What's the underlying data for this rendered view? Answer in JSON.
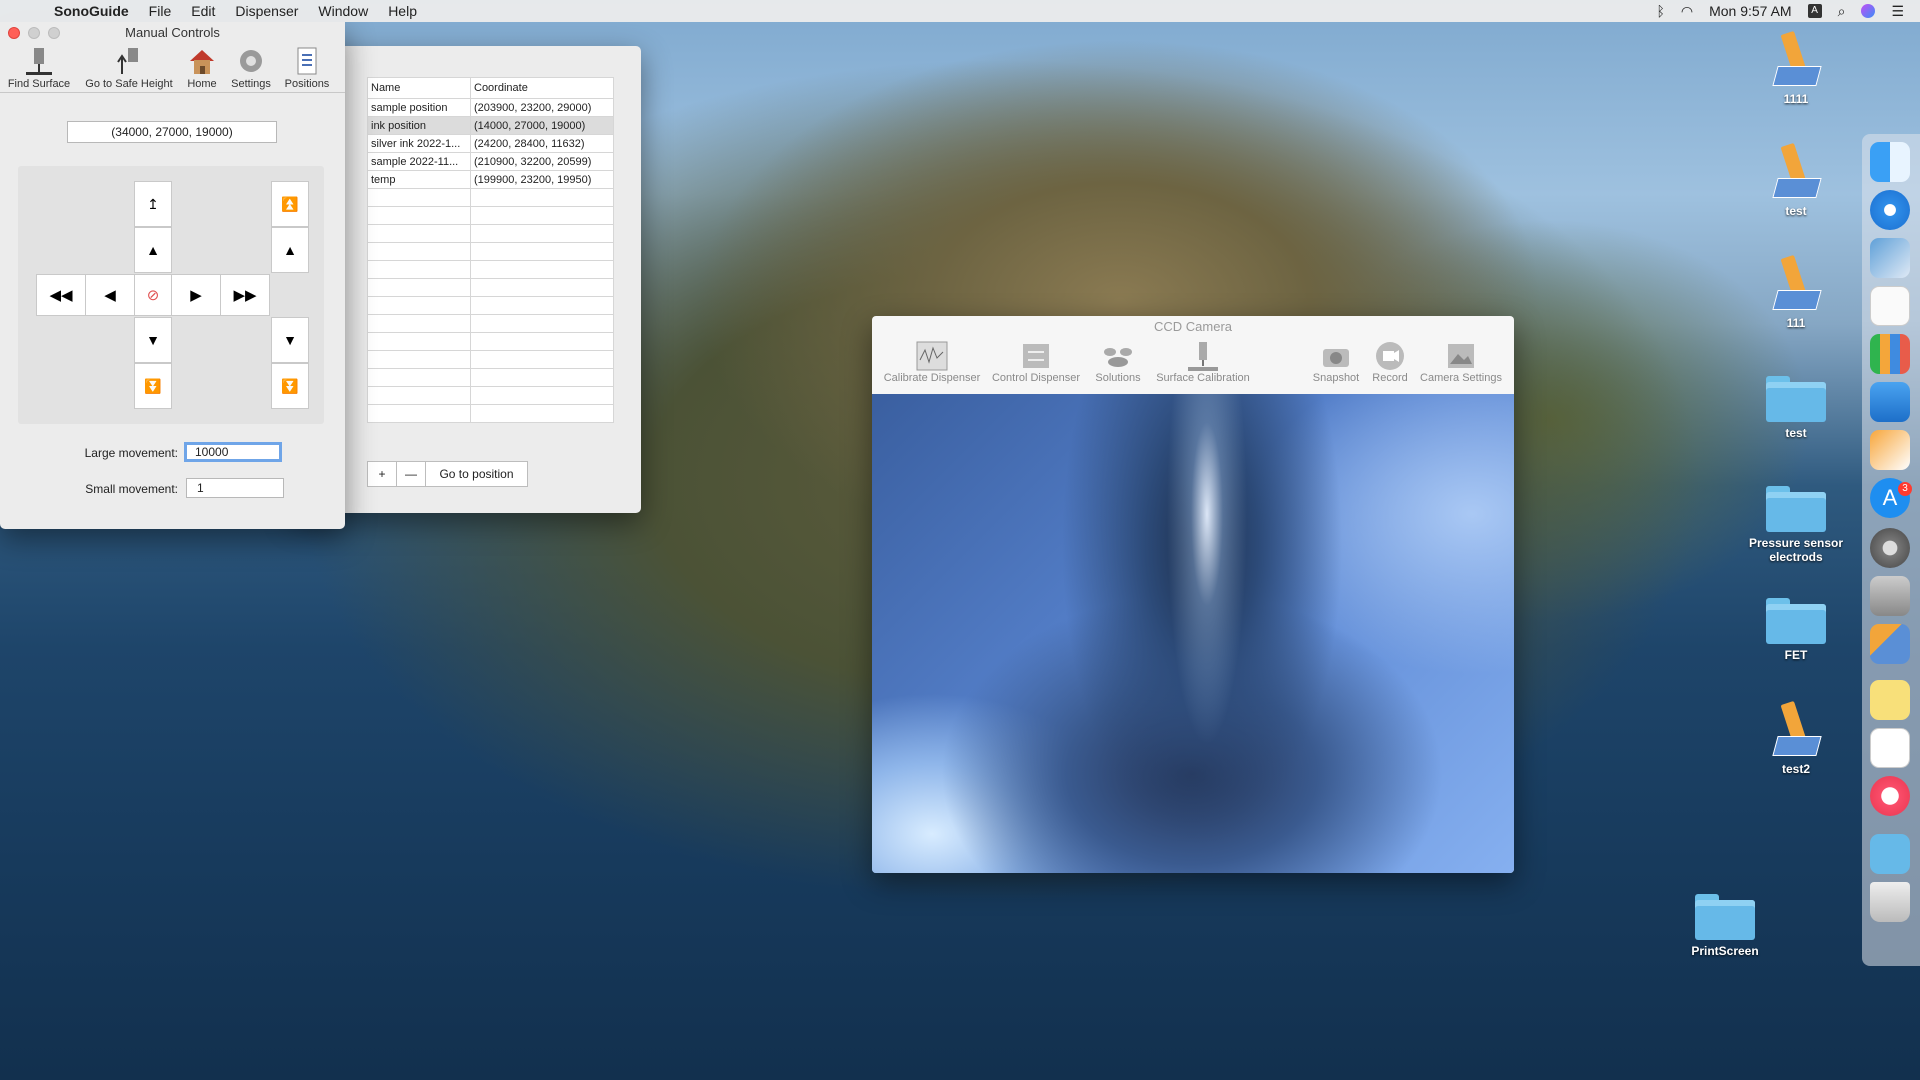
{
  "menubar": {
    "app_name": "SonoGuide",
    "menus": [
      "File",
      "Edit",
      "Dispenser",
      "Window",
      "Help"
    ],
    "clock": "Mon 9:57 AM",
    "input_source": "A"
  },
  "manual_controls": {
    "title": "Manual Controls",
    "toolbar": {
      "find_surface": "Find Surface",
      "safe_height": "Go to Safe Height",
      "home": "Home",
      "settings": "Settings",
      "positions": "Positions"
    },
    "current_coordinate": "(34000, 27000, 19000)",
    "large_movement_label": "Large movement:",
    "large_movement_value": "10000",
    "small_movement_label": "Small movement:",
    "small_movement_value": "1"
  },
  "positions": {
    "columns": [
      "Name",
      "Coordinate"
    ],
    "rows": [
      {
        "name": "sample position",
        "coord": "(203900, 23200, 29000)"
      },
      {
        "name": "ink position",
        "coord": "(14000, 27000, 19000)"
      },
      {
        "name": "silver ink 2022-1...",
        "coord": "(24200, 28400, 11632)"
      },
      {
        "name": "sample 2022-11...",
        "coord": "(210900, 32200, 20599)"
      },
      {
        "name": "temp",
        "coord": "(199900, 23200, 19950)"
      }
    ],
    "add_label": "+",
    "remove_label": "—",
    "go_label": "Go to position"
  },
  "camera": {
    "title": "CCD Camera",
    "tools": {
      "calibrate": "Calibrate Dispenser",
      "control": "Control Dispenser",
      "solutions": "Solutions",
      "surface": "Surface Calibration",
      "snapshot": "Snapshot",
      "record": "Record",
      "settings": "Camera Settings"
    }
  },
  "desktop": {
    "icons": [
      "1111",
      "test",
      "111",
      "test",
      "Pressure sensor electrods",
      "FET",
      "test2",
      "PrintScreen"
    ]
  },
  "dock": {
    "appstore_badge": "3"
  }
}
